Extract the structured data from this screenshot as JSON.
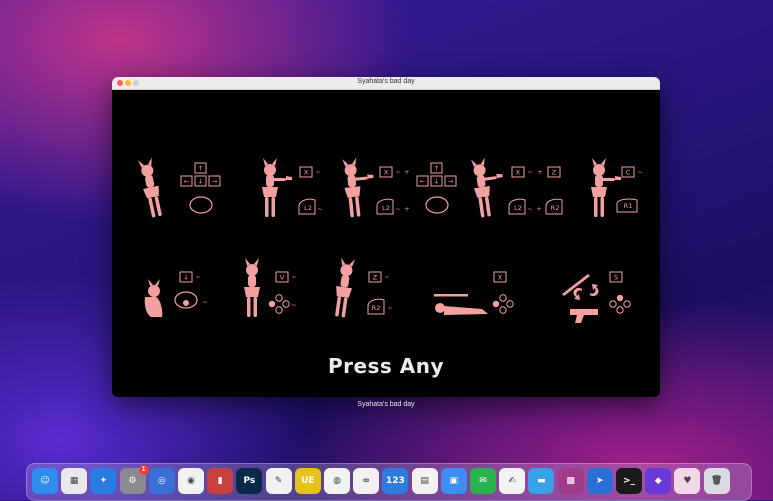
{
  "window": {
    "title": "Syahata's bad day",
    "caption": "Syahata's bad day"
  },
  "game": {
    "press_text": "Press Any",
    "keys": {
      "up": "↑",
      "left": "←",
      "down": "↓",
      "right": "→",
      "x": "X",
      "z": "Z",
      "c": "C",
      "v": "V",
      "s": "S",
      "l2": "L2",
      "r2": "R2",
      "r1": "R1"
    },
    "tilde": "~",
    "plus": "+"
  },
  "dock": {
    "items": [
      {
        "name": "finder",
        "color": "#2f8df0",
        "glyph": "☺"
      },
      {
        "name": "launchpad",
        "color": "#e8e8ee",
        "glyph": "▦"
      },
      {
        "name": "safari",
        "color": "#2a7de0",
        "glyph": "✦"
      },
      {
        "name": "system-preferences",
        "color": "#8a8a92",
        "glyph": "⚙",
        "badge": "1"
      },
      {
        "name": "app-blue",
        "color": "#3b6fd8",
        "glyph": "◎"
      },
      {
        "name": "qq",
        "color": "#f2f2f2",
        "glyph": "◉"
      },
      {
        "name": "app-screen",
        "color": "#c94040",
        "glyph": "▮"
      },
      {
        "name": "photoshop",
        "color": "#0a2a4a",
        "glyph": "Ps"
      },
      {
        "name": "app-pencil",
        "color": "#f2f2f2",
        "glyph": "✎"
      },
      {
        "name": "ultraedit",
        "color": "#e6c21a",
        "glyph": "UE"
      },
      {
        "name": "chrome",
        "color": "#f2f2f2",
        "glyph": "◍"
      },
      {
        "name": "baidu-netdisk",
        "color": "#f2f2f2",
        "glyph": "∞"
      },
      {
        "name": "numbers-123",
        "color": "#2f7be0",
        "glyph": "123"
      },
      {
        "name": "printer",
        "color": "#f2f2f2",
        "glyph": "▤"
      },
      {
        "name": "app-blue-square",
        "color": "#3d8ef0",
        "glyph": "▣"
      },
      {
        "name": "wechat",
        "color": "#2bb24c",
        "glyph": "✉"
      },
      {
        "name": "textedit",
        "color": "#f2f2f2",
        "glyph": "✍"
      },
      {
        "name": "folder",
        "color": "#3aa0e8",
        "glyph": "▬"
      },
      {
        "name": "winrar",
        "color": "#a23a8a",
        "glyph": "▩"
      },
      {
        "name": "app-compass",
        "color": "#2b6fd6",
        "glyph": "➤"
      },
      {
        "name": "terminal",
        "color": "#1a1a1a",
        "glyph": ">_"
      },
      {
        "name": "app-purple",
        "color": "#6a3ad8",
        "glyph": "◆"
      },
      {
        "name": "anime-app",
        "color": "#f0d8e6",
        "glyph": "♥"
      },
      {
        "name": "trash",
        "color": "#d8dce2",
        "glyph": "🗑"
      }
    ]
  }
}
